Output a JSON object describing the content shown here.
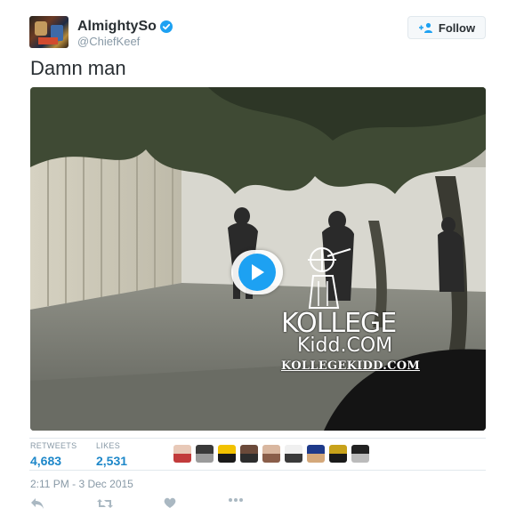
{
  "header": {
    "display_name": "AlmightySo",
    "handle": "@ChiefKeef",
    "verified": true,
    "follow_label": "Follow"
  },
  "tweet": {
    "text": "Damn man",
    "media": {
      "type": "video",
      "watermark_line1": "KOLLEGE",
      "watermark_line2": "Kidd.COM",
      "watermark_line3": "KOLLEGEKIDD.COM"
    }
  },
  "stats": {
    "retweets_label": "RETWEETS",
    "retweets_value": "4,683",
    "likes_label": "LIKES",
    "likes_value": "2,531"
  },
  "likers": [
    {
      "name": "liker-1",
      "colors": [
        "#e8c9b8",
        "#c23b3b"
      ]
    },
    {
      "name": "liker-2",
      "colors": [
        "#3a3a3a",
        "#9b9b9b"
      ]
    },
    {
      "name": "liker-3",
      "colors": [
        "#f2c200",
        "#1a1a1a"
      ]
    },
    {
      "name": "liker-4",
      "colors": [
        "#6b4a3a",
        "#2d2d2d"
      ]
    },
    {
      "name": "liker-5",
      "colors": [
        "#d9b7a0",
        "#8a5e4a"
      ]
    },
    {
      "name": "liker-6",
      "colors": [
        "#f0f0f0",
        "#3a3a3a"
      ]
    },
    {
      "name": "liker-7",
      "colors": [
        "#1e3a8a",
        "#d4a87a"
      ]
    },
    {
      "name": "liker-8",
      "colors": [
        "#c8a21a",
        "#1a1a1a"
      ]
    },
    {
      "name": "liker-9",
      "colors": [
        "#222222",
        "#bbbbbb"
      ]
    }
  ],
  "timestamp": "2:11 PM - 3 Dec 2015",
  "colors": {
    "accent": "#1da1f2",
    "stat_value": "#1d87c9",
    "muted": "#8899a6"
  },
  "actions": [
    "reply-icon",
    "retweet-icon",
    "like-icon",
    "more-icon"
  ]
}
